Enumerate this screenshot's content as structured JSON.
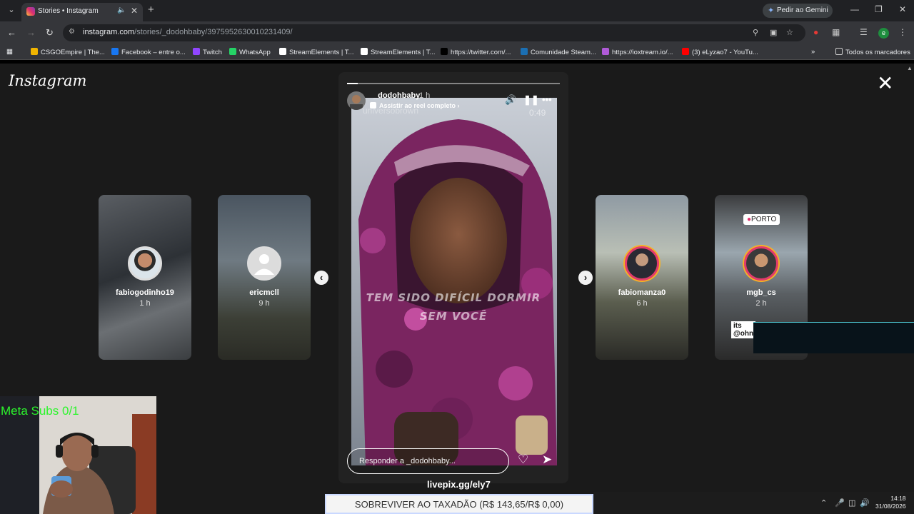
{
  "browser": {
    "tab_title": "Stories • Instagram",
    "gemini_label": "Pedir ao Gemini",
    "url_host": "instagram.com",
    "url_path": "/stories/_dodohbaby/3975952630010231409/",
    "profile_initial": "e",
    "bookmarks": [
      {
        "label": "CSGOEmpire | The...",
        "color": "#f0b400"
      },
      {
        "label": "Facebook – entre o...",
        "color": "#1877f2"
      },
      {
        "label": "Twitch",
        "color": "#9146ff"
      },
      {
        "label": "WhatsApp",
        "color": "#25d366"
      },
      {
        "label": "StreamElements | T...",
        "color": "#ffffff"
      },
      {
        "label": "StreamElements | T...",
        "color": "#ffffff"
      },
      {
        "label": "https://twitter.com/...",
        "color": "#000000"
      },
      {
        "label": "Comunidade Steam...",
        "color": "#1b6fb3"
      },
      {
        "label": "https://ioxtream.io/...",
        "color": "#b05bd8"
      },
      {
        "label": "(3) eLyzao7 - YouTu...",
        "color": "#ff0000"
      }
    ],
    "all_bookmarks_label": "Todos os marcadores"
  },
  "instagram": {
    "logo": "Instagram",
    "side_stories": [
      {
        "username": "fabiogodinho19",
        "time": "1 h"
      },
      {
        "username": "ericmcll",
        "time": "9 h"
      },
      {
        "username": "fabiomanza0",
        "time": "6 h"
      },
      {
        "username": "mgb_cs",
        "time": "2 h"
      }
    ],
    "porto_tag": "PORTO",
    "sticker_text_1": "its",
    "sticker_text_2": "@ohn",
    "active_story": {
      "username": "_dodohbaby",
      "time": "1 h",
      "reel_link": "Assistir ao reel completo",
      "watermark": "universobrown",
      "duration": "0:49",
      "caption_line1": "TEM SIDO DIFÍCIL DORMIR",
      "caption_line2": "SEM VOCÊ",
      "progress": 0.05,
      "reply_placeholder": "Responder a _dodohbaby..."
    }
  },
  "overlays": {
    "meta_subs": "Meta Subs 0/1",
    "livepix": "livepix.gg/ely7",
    "banner": "SOBREVIVER AO TAXADÃO (R$ 143,65/R$ 0,00)"
  },
  "taskbar": {
    "time": "14:18",
    "date": "31/08/2026"
  }
}
